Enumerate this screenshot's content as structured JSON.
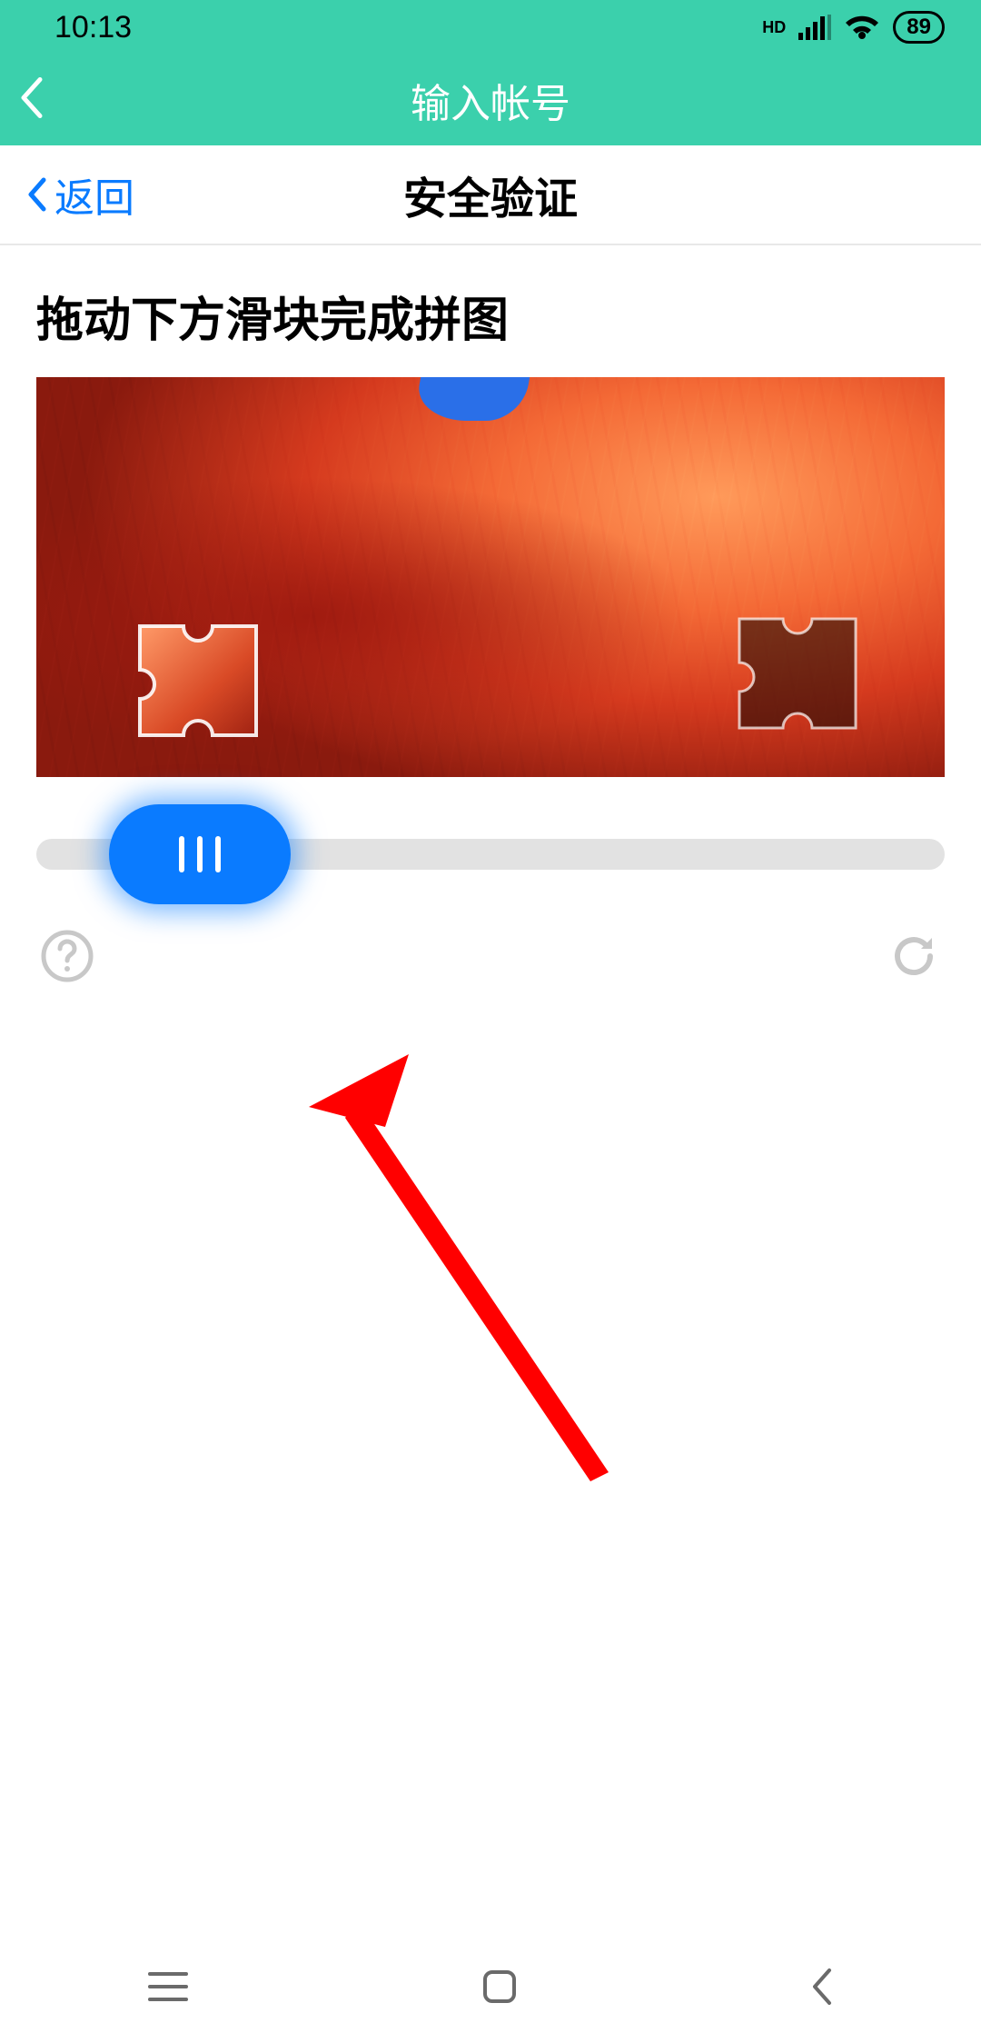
{
  "status": {
    "time": "10:13",
    "battery": "89"
  },
  "header": {
    "title": "输入帐号"
  },
  "subheader": {
    "back": "返回",
    "title": "安全验证"
  },
  "captcha": {
    "instruction": "拖动下方滑块完成拼图"
  }
}
